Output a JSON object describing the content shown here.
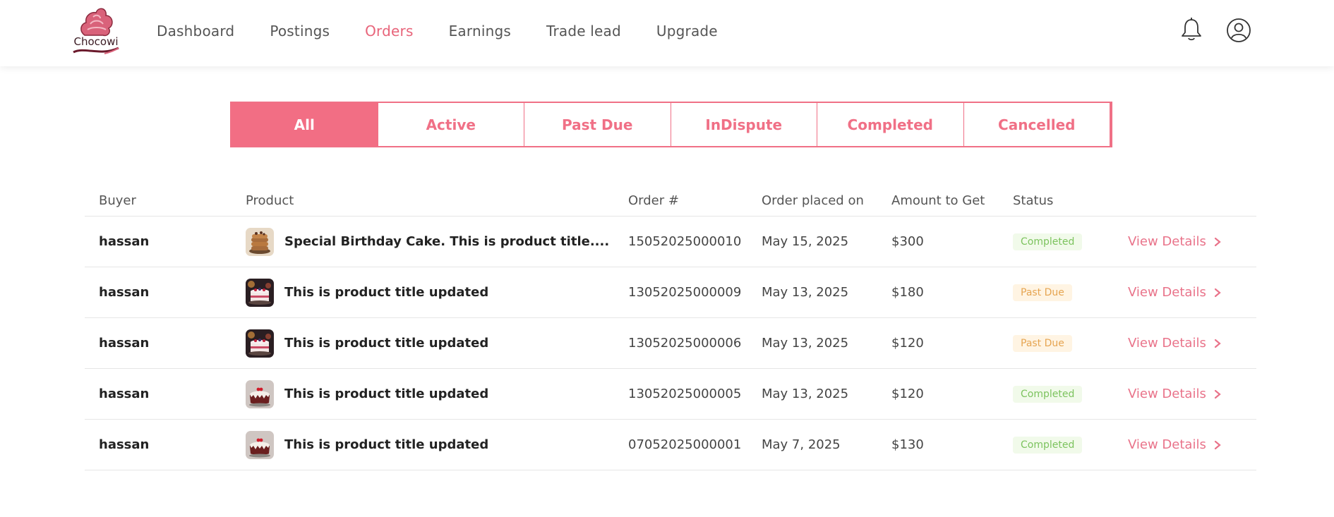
{
  "header": {
    "logo_text": "Chocowi",
    "nav": [
      {
        "label": "Dashboard",
        "active": false
      },
      {
        "label": "Postings",
        "active": false
      },
      {
        "label": "Orders",
        "active": true
      },
      {
        "label": "Earnings",
        "active": false
      },
      {
        "label": "Trade lead",
        "active": false
      },
      {
        "label": "Upgrade",
        "active": false
      }
    ],
    "icons": [
      "bell-icon",
      "user-icon"
    ]
  },
  "tabs": [
    {
      "label": "All",
      "active": true
    },
    {
      "label": "Active",
      "active": false
    },
    {
      "label": "Past Due",
      "active": false
    },
    {
      "label": "InDispute",
      "active": false
    },
    {
      "label": "Completed",
      "active": false
    },
    {
      "label": "Cancelled",
      "active": false
    }
  ],
  "table": {
    "columns": [
      "Buyer",
      "Product",
      "Order #",
      "Order placed on",
      "Amount to Get",
      "Status"
    ],
    "action_label": "View Details",
    "rows": [
      {
        "buyer": "hassan",
        "product": "Special Birthday Cake. This is product title....",
        "thumb": "pancake-stack",
        "order": "15052025000010",
        "date": "May 15, 2025",
        "amount": "$300",
        "status": "Completed",
        "status_kind": "completed"
      },
      {
        "buyer": "hassan",
        "product": "This is product title updated",
        "thumb": "berry-cake",
        "order": "13052025000009",
        "date": "May 13, 2025",
        "amount": "$180",
        "status": "Past Due",
        "status_kind": "pastdue"
      },
      {
        "buyer": "hassan",
        "product": "This is product title updated",
        "thumb": "berry-cake",
        "order": "13052025000006",
        "date": "May 13, 2025",
        "amount": "$120",
        "status": "Past Due",
        "status_kind": "pastdue"
      },
      {
        "buyer": "hassan",
        "product": "This is product title updated",
        "thumb": "bundt-cake",
        "order": "13052025000005",
        "date": "May 13, 2025",
        "amount": "$120",
        "status": "Completed",
        "status_kind": "completed"
      },
      {
        "buyer": "hassan",
        "product": "This is product title updated",
        "thumb": "bundt-cake",
        "order": "07052025000001",
        "date": "May 7, 2025",
        "amount": "$130",
        "status": "Completed",
        "status_kind": "completed"
      }
    ]
  },
  "colors": {
    "accent": "#f26e84",
    "completed_text": "#7cc35e",
    "completed_bg": "#f1faea",
    "pastdue_text": "#e6a552",
    "pastdue_bg": "#fff4e3"
  }
}
